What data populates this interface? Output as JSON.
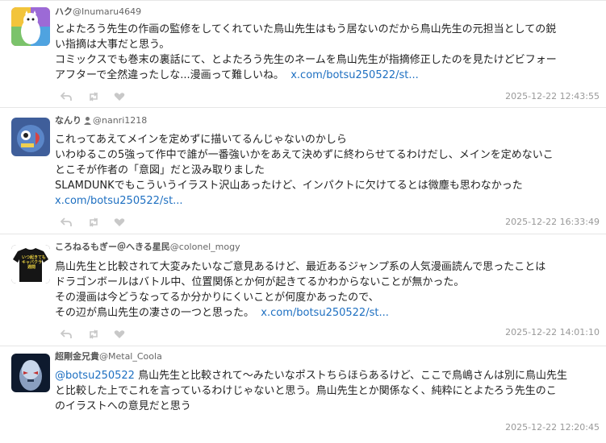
{
  "tweets": [
    {
      "name": "ハク",
      "handle": "@Inumaru4649",
      "lines": [
        "とよたろう先生の作画の監修をしてくれていた鳥山先生はもう居ないのだから鳥山先生の元担当としての鋭",
        "い指摘は大事だと思う。",
        "コミックスでも巻末の裏話にて、とよたろう先生のネームを鳥山先生が指摘修正したのを見たけどビフォー",
        "アフターで全然違ったしな...漫画って難しいね。"
      ],
      "link": "x.com/botsu250522/st...",
      "time": "2025-12-22 12:43:55"
    },
    {
      "name": "なんり",
      "handle": "@nanri1218",
      "lines": [
        "これってあえてメインを定めずに描いてるんじゃないのかしら",
        "いわゆるこの5強って作中で誰が一番強いかをあえて決めずに終わらせてるわけだし、メインを定めないこ",
        "とこそが作者の「意図」だと汲み取りました",
        "SLAMDUNKでもこういうイラスト沢山あったけど、インパクトに欠けてるとは微塵も思わなかった"
      ],
      "link": "x.com/botsu250522/st...",
      "time": "2025-12-22 16:33:49"
    },
    {
      "name": "ころねるもぎー＠へきる星民",
      "handle": "@colonel_mogy",
      "lines": [
        "鳥山先生と比較されて大変みたいなご意見あるけど、最近あるジャンプ系の人気漫画読んで思ったことは",
        "ドラゴンボールはバトル中、位置関係とか何が起きてるかわからないことが無かった。",
        "その漫画は今どうなってるか分かりにくいことが何度かあったので、",
        "その辺が鳥山先生の凄さの一つと思った。"
      ],
      "link": "x.com/botsu250522/st...",
      "time": "2025-12-22 14:01:10"
    },
    {
      "name": "超剛金兄貴",
      "handle": "@Metal_Coola",
      "mention": "@botsu250522",
      "lines": [
        " 鳥山先生と比較されて～みたいなポストちらほらあるけど、ここで鳥嶋さんは別に鳥山先生",
        "と比較した上でこれを言っているわけじゃないと思う。鳥山先生とか関係なく、純粋にとよたろう先生のこ",
        "のイラストへの意見だと思う"
      ],
      "time": "2025-12-22 12:20:45"
    }
  ],
  "icons": {
    "reply": "reply-icon",
    "retweet": "retweet-icon",
    "like": "heart-icon",
    "badge": "user-badge-icon"
  },
  "avatar_text": {
    "colonel_shirt": "いつ起きても\nキャパクラ\n週間"
  }
}
